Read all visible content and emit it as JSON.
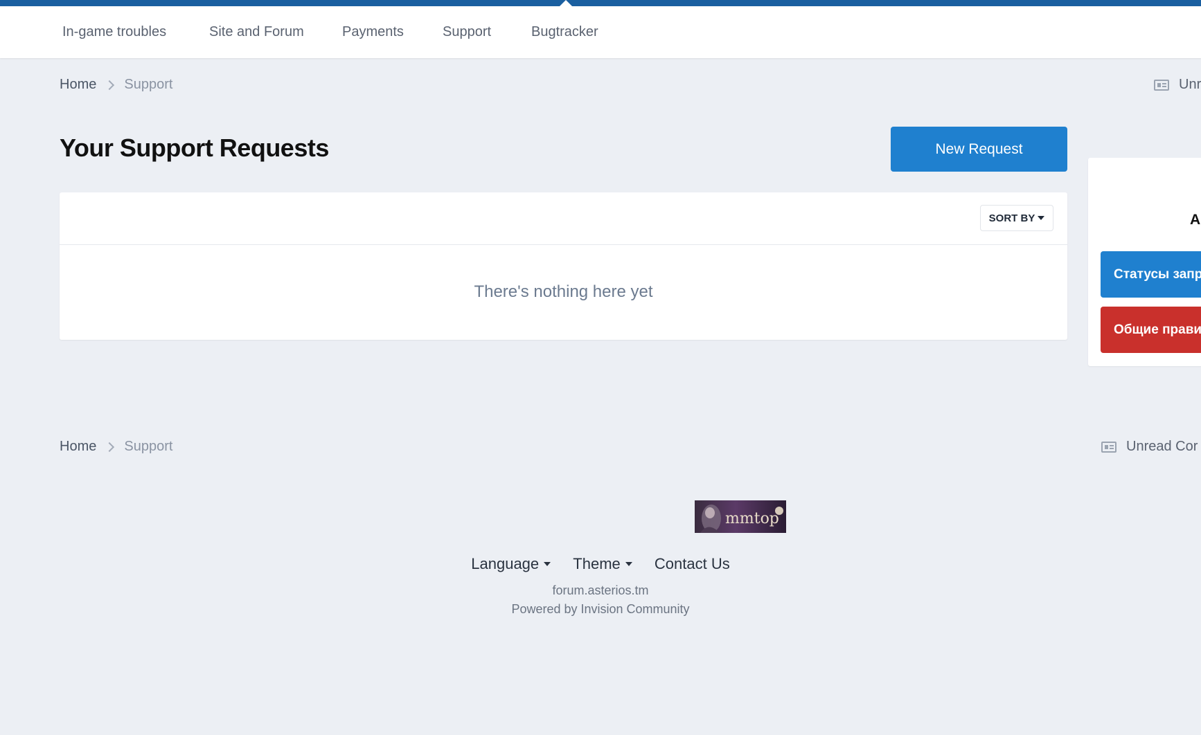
{
  "nav": {
    "items": [
      {
        "label": "In-game troubles"
      },
      {
        "label": "Site and Forum"
      },
      {
        "label": "Payments"
      },
      {
        "label": "Support"
      },
      {
        "label": "Bugtracker"
      }
    ]
  },
  "breadcrumb": {
    "home": "Home",
    "current": "Support"
  },
  "unread": {
    "top_label": "Unr",
    "bottom_label": "Unread Cor"
  },
  "main": {
    "title": "Your Support Requests",
    "new_request_label": "New Request",
    "sort_label": "SORT BY",
    "empty_message": "There's nothing here yet"
  },
  "sidebar": {
    "heading_fragment": "A",
    "status_button_label": "Статусы запр",
    "rules_button_label": "Общие прави"
  },
  "footer": {
    "logo_text": "mmtop",
    "language_label": "Language",
    "theme_label": "Theme",
    "contact_label": "Contact Us",
    "site_name": "forum.asterios.tm",
    "powered_by": "Powered by Invision Community"
  },
  "colors": {
    "accent_blue": "#1f80cf",
    "top_bar": "#1a5fa0",
    "danger_red": "#c9302c",
    "page_bg": "#eceff4"
  },
  "icons": {
    "unread": "newspaper-icon",
    "breadcrumb_separator": "chevron-right-icon",
    "dropdown": "caret-down-icon"
  }
}
